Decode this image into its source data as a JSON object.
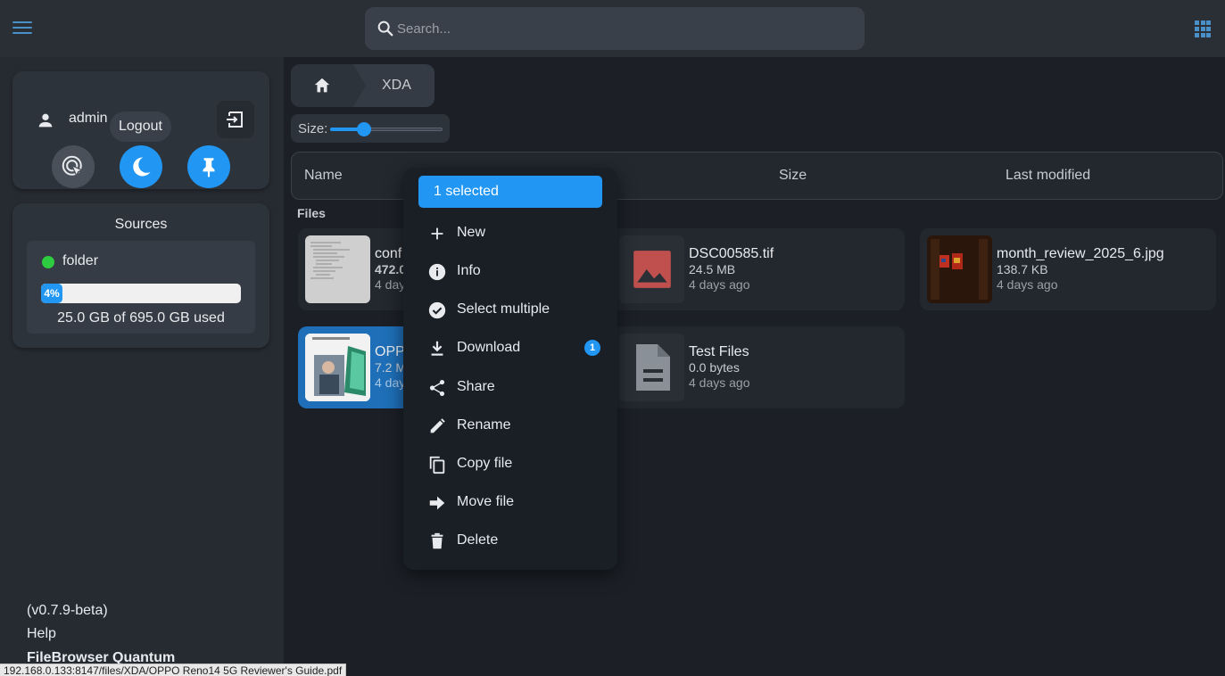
{
  "header": {
    "search_placeholder": "Search..."
  },
  "sidebar": {
    "user": {
      "name": "admin"
    },
    "tooltip": "Logout",
    "sources": {
      "title": "Sources",
      "items": [
        {
          "name": "folder",
          "status_color": "#2ecc40",
          "usage_percent_label": "4%",
          "usage_fraction": 0.04,
          "usage_text": "25.0 GB of 695.0 GB used"
        }
      ]
    },
    "version": "(v0.7.9-beta)",
    "help": "Help",
    "brand": "FileBrowser Quantum"
  },
  "breadcrumb": {
    "current": "XDA"
  },
  "size_control": {
    "label": "Size:",
    "level": 0.3
  },
  "columns": {
    "name": "Name",
    "size": "Size",
    "modified": "Last modified"
  },
  "section": {
    "files": "Files"
  },
  "files": [
    {
      "name": "conf",
      "size": "472.0",
      "modified": "4 days"
    },
    {
      "name": "DSC00585.tif",
      "size": "24.5 MB",
      "modified": "4 days ago"
    },
    {
      "name": "month_review_2025_6.jpg",
      "size": "138.7 KB",
      "modified": "4 days ago"
    },
    {
      "name": "OPP",
      "size": "7.2 M",
      "modified": "4 day"
    },
    {
      "name": "Test Files",
      "size": "0.0 bytes",
      "modified": "4 days ago"
    }
  ],
  "context_menu": {
    "header": "1 selected",
    "items": [
      "New",
      "Info",
      "Select multiple",
      "Download",
      "Share",
      "Rename",
      "Copy file",
      "Move file",
      "Delete"
    ],
    "download_badge": "1"
  },
  "colors": {
    "accent": "#2196f3",
    "image_placeholder": "#c0504d"
  },
  "status_url": "192.168.0.133:8147/files/XDA/OPPO Reno14 5G Reviewer's Guide.pdf"
}
